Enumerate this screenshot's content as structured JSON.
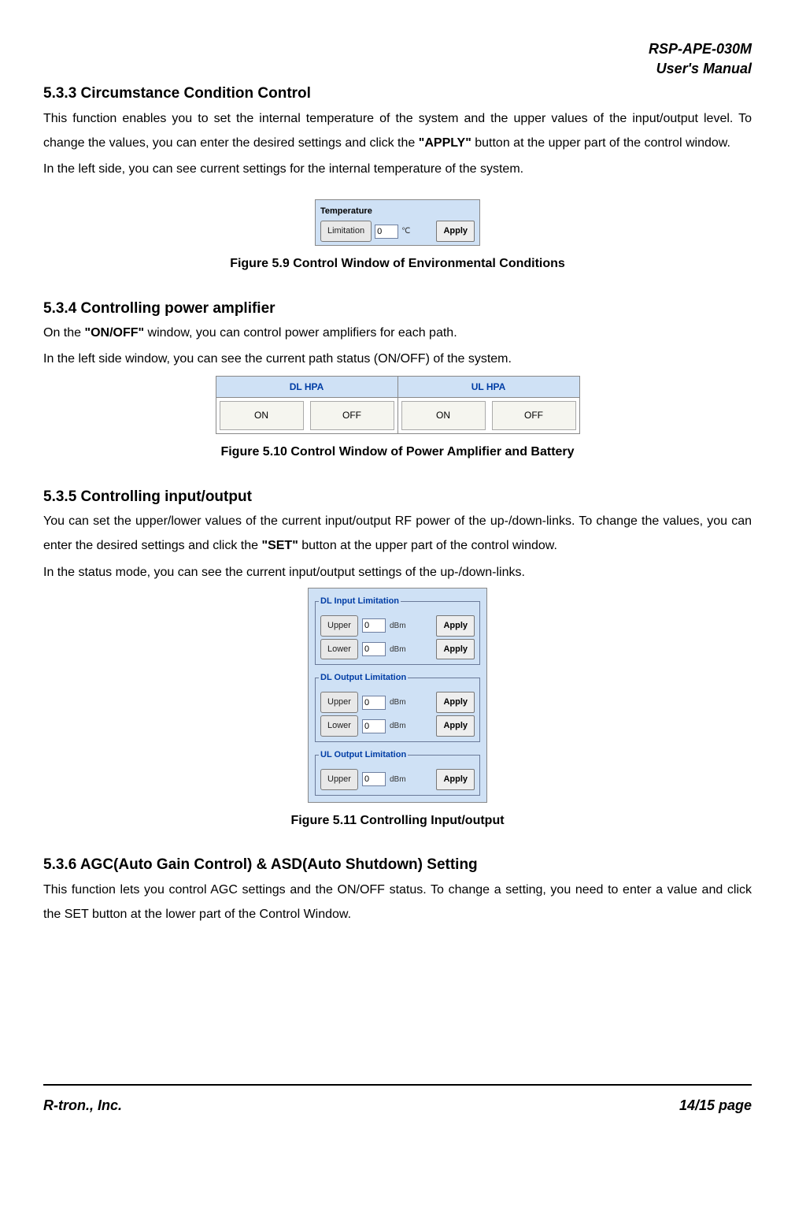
{
  "header": {
    "line1": "RSP-APE-030M",
    "line2": "User's Manual"
  },
  "s533": {
    "heading": "5.3.3 Circumstance Condition Control",
    "p1_a": "This function enables you to set the internal temperature of the system and the upper values of the input/output level. To change the values, you can enter the desired settings and click the ",
    "p1_bold": "\"APPLY\"",
    "p1_b": " button at the upper part of the control window.",
    "p2": "In the left side, you can see current settings for the internal temperature of the system."
  },
  "fig59": {
    "panel_title": "Temperature",
    "label_btn": "Limitation",
    "value": "0",
    "unit": "℃",
    "apply": "Apply",
    "caption": "Figure 5.9 Control Window of Environmental Conditions"
  },
  "s534": {
    "heading": "5.3.4 Controlling power amplifier",
    "p1_a": "On the ",
    "p1_bold": "\"ON/OFF\"",
    "p1_b": " window, you can control power amplifiers for each path.",
    "p2": "In the left side window, you can see the current path status (ON/OFF) of the system."
  },
  "fig510": {
    "g1_title": "DL HPA",
    "g2_title": "UL HPA",
    "on": "ON",
    "off": "OFF",
    "caption": "Figure 5.10 Control Window of Power Amplifier and Battery"
  },
  "s535": {
    "heading": "5.3.5 Controlling input/output",
    "p1_a": "You can set the upper/lower values of the current input/output RF power of the up-/down-links. To change the values, you can enter the desired settings and click the ",
    "p1_bold": "\"SET\"",
    "p1_b": " button at the upper part of the control window.",
    "p2": "In the status mode, you can see the current input/output settings of the up-/down-links."
  },
  "fig511": {
    "fs1_legend": "DL Input Limitation",
    "fs1_r1_label": "Upper",
    "fs1_r1_val": "0",
    "fs1_r2_label": "Lower",
    "fs1_r2_val": "0",
    "fs2_legend": "DL Output Limitation",
    "fs2_r1_label": "Upper",
    "fs2_r1_val": "0",
    "fs2_r2_label": "Lower",
    "fs2_r2_val": "0",
    "fs3_legend": "UL Output Limitation",
    "fs3_r1_label": "Upper",
    "fs3_r1_val": "0",
    "unit": "dBm",
    "apply": "Apply",
    "caption": "Figure 5.11 Controlling Input/output"
  },
  "s536": {
    "heading": "5.3.6 AGC(Auto Gain Control) & ASD(Auto Shutdown) Setting",
    "p1": "This function lets you control AGC settings and the ON/OFF status. To change a setting, you need to enter a value and click the SET button at the lower part of the Control Window."
  },
  "footer": {
    "left": "R-tron., Inc.",
    "right": "14/15 page"
  }
}
